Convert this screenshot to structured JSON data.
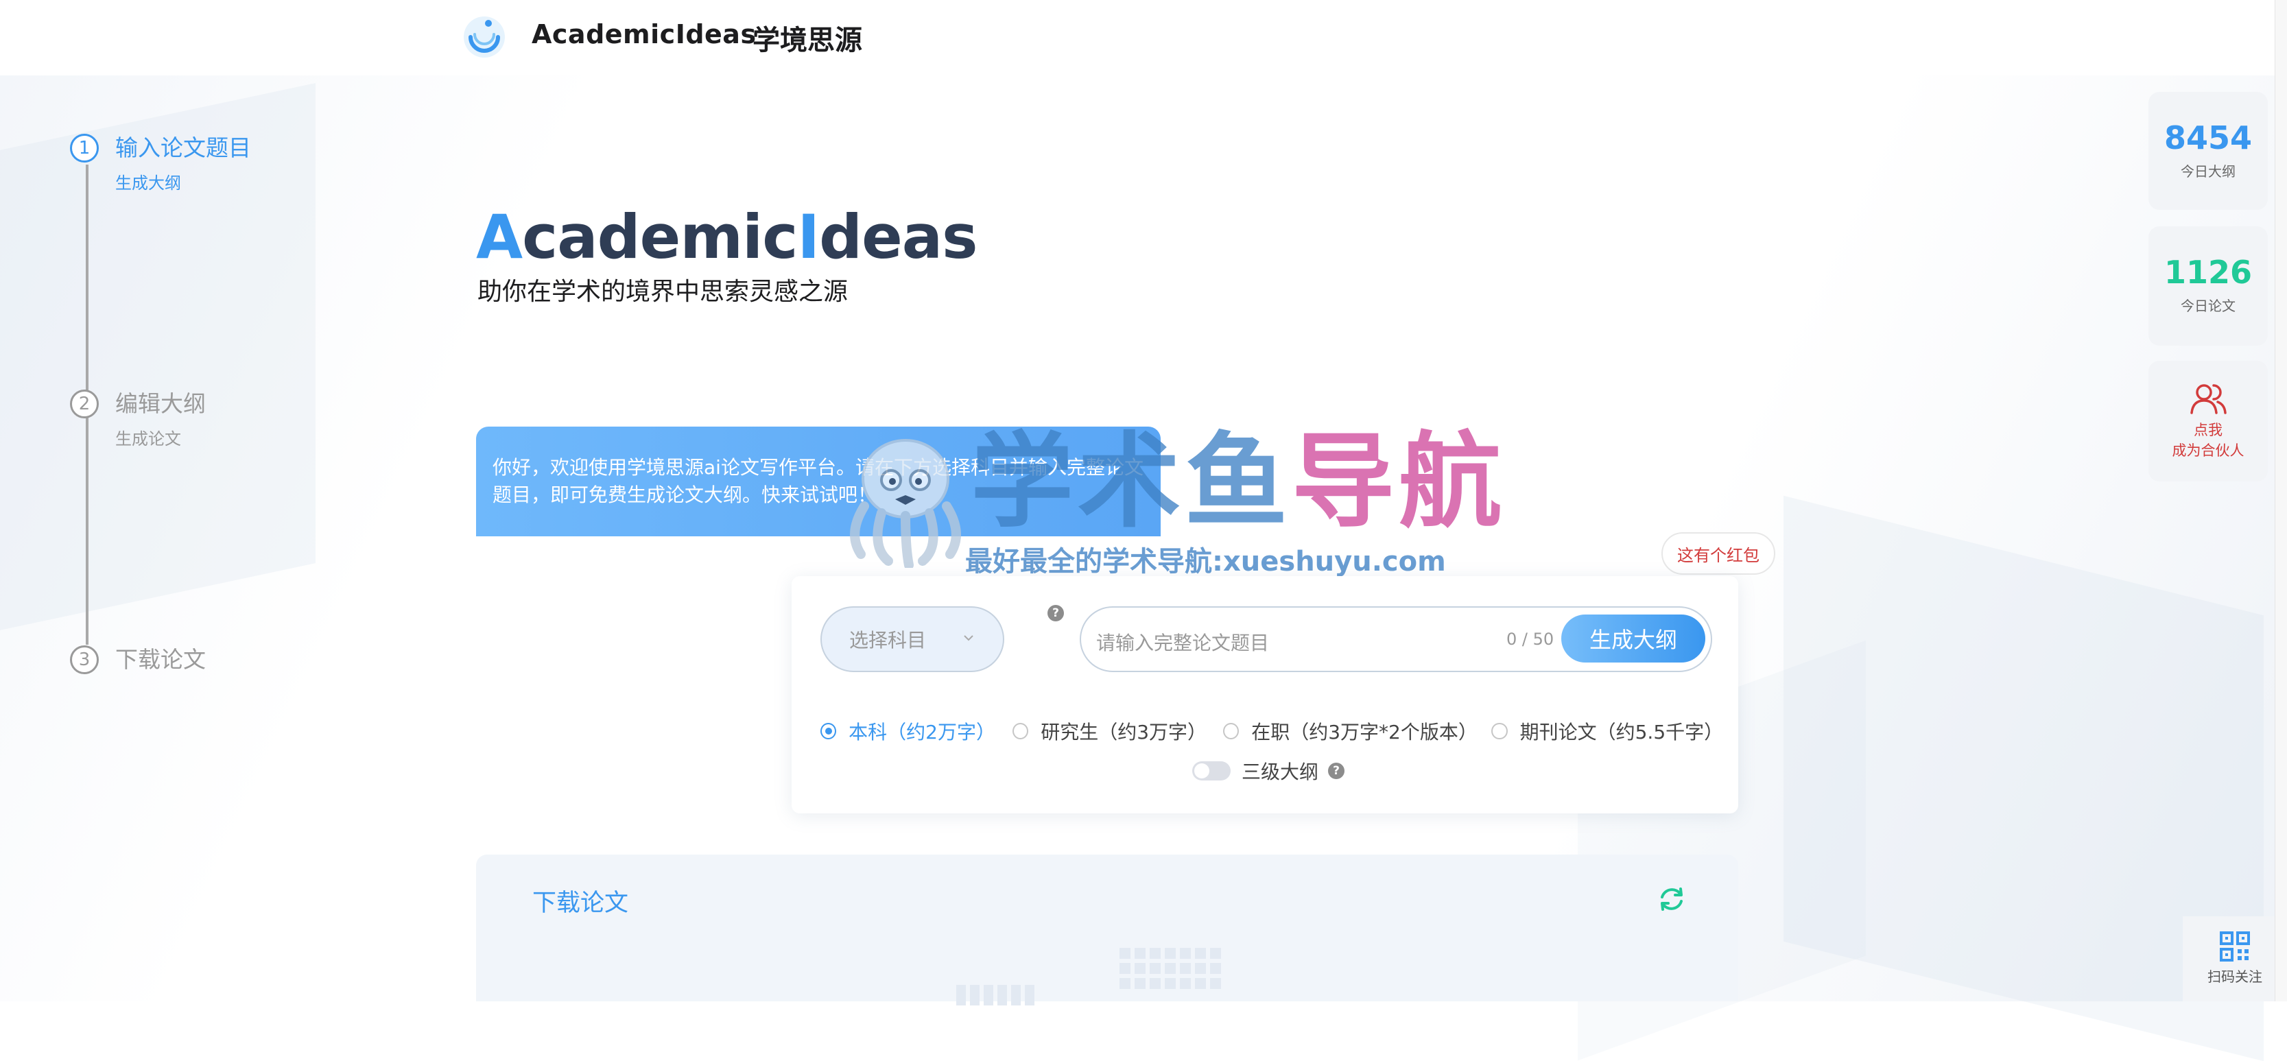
{
  "header": {
    "brand_en": "AcademicIdeas",
    "brand_cn": "学境思源"
  },
  "steps": [
    {
      "number": "1",
      "title": "输入论文题目",
      "sub": "生成大纲",
      "active": true
    },
    {
      "number": "2",
      "title": "编辑大纲",
      "sub": "生成论文",
      "active": false
    },
    {
      "number": "3",
      "title": "下载论文",
      "sub": "",
      "active": false
    }
  ],
  "hero": {
    "title_first": "A",
    "title_mid": "cademic",
    "title_i": "I",
    "title_end": "deas",
    "subtitle": "助你在学术的境界中思索灵感之源"
  },
  "welcome": {
    "text": "你好，欢迎使用学境思源ai论文写作平台。请在下方选择科目并输入完整论文题目，即可免费生成论文大纲。快来试试吧！"
  },
  "watermark": {
    "big_part1": "学术鱼",
    "big_part2": "导航",
    "small": "最好最全的学术导航:xueshuyu.com"
  },
  "form": {
    "subject_placeholder": "选择科目",
    "topic_placeholder": "请输入完整论文题目",
    "counter": "0 / 50",
    "generate_label": "生成大纲",
    "help_mark": "?",
    "levels": [
      {
        "label": "本科（约2万字）",
        "selected": true
      },
      {
        "label": "研究生（约3万字）",
        "selected": false
      },
      {
        "label": "在职（约3万字*2个版本）",
        "selected": false
      },
      {
        "label": "期刊论文（约5.5千字）",
        "selected": false
      }
    ],
    "toggle_label": "三级大纲",
    "toggle_on": false
  },
  "redpack": {
    "tip": "这有个红包"
  },
  "download": {
    "title": "下载论文"
  },
  "stats": [
    {
      "value": "8454",
      "label": "今日大纲",
      "color": "#3a97ef"
    },
    {
      "value": "1126",
      "label": "今日论文",
      "color": "#20c997"
    }
  ],
  "partner": {
    "line1": "点我",
    "line2": "成为合伙人"
  },
  "qr": {
    "label": "扫码关注"
  },
  "colors": {
    "accent": "#3a97ef",
    "green": "#20c997",
    "red": "#d23b3b"
  }
}
